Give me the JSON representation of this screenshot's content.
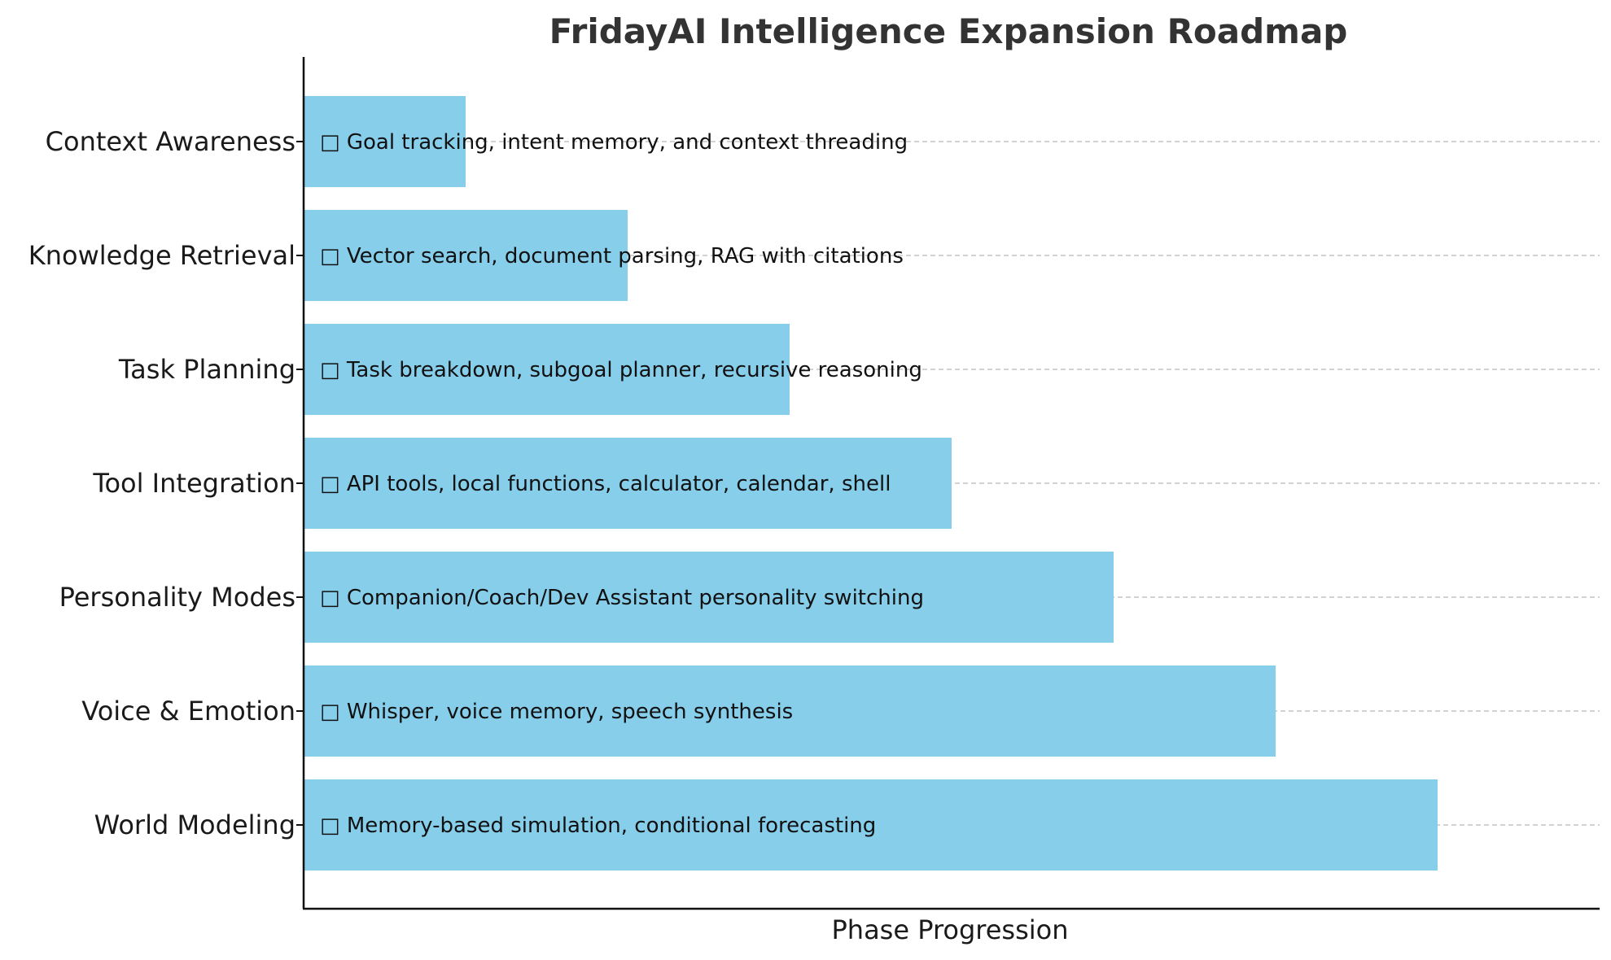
{
  "chart_data": {
    "type": "bar",
    "orientation": "horizontal",
    "title": "FridayAI Intelligence Expansion Roadmap",
    "xlabel": "Phase Progression",
    "ylabel": "",
    "categories": [
      "Context Awareness",
      "Knowledge Retrieval",
      "Task Planning",
      "Tool Integration",
      "Personality Modes",
      "Voice & Emotion",
      "World Modeling"
    ],
    "values": [
      1,
      2,
      3,
      4,
      5,
      6,
      7
    ],
    "xlim": [
      0,
      8
    ],
    "bar_labels": [
      "Goal tracking, intent memory, and context threading",
      "Vector search, document parsing, RAG with citations",
      "Task breakdown, subgoal planner, recursive reasoning",
      "API tools, local functions, calculator, calendar, shell",
      "Companion/Coach/Dev Assistant personality switching",
      "Whisper, voice memory, speech synthesis",
      "Memory-based simulation, conditional forecasting"
    ],
    "label_prefix_glyph": "□",
    "bar_color": "#87CEEB",
    "grid": "x-dashed",
    "legend": "none"
  }
}
